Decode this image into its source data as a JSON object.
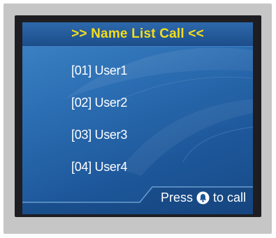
{
  "screen": {
    "title": ">> Name List Call <<",
    "names": [
      {
        "label": "[01] User1"
      },
      {
        "label": "[02] User2"
      },
      {
        "label": "[03] User3"
      },
      {
        "label": "[04] User4"
      }
    ],
    "footer": {
      "press_label": "Press",
      "icon": "bell-icon",
      "call_label": "to call"
    }
  },
  "colors": {
    "title_text": "#f5dd1b",
    "screen_blue": "#2c6eb3",
    "footer_text": "#ffffff",
    "bezel": "#c6c6c6"
  }
}
